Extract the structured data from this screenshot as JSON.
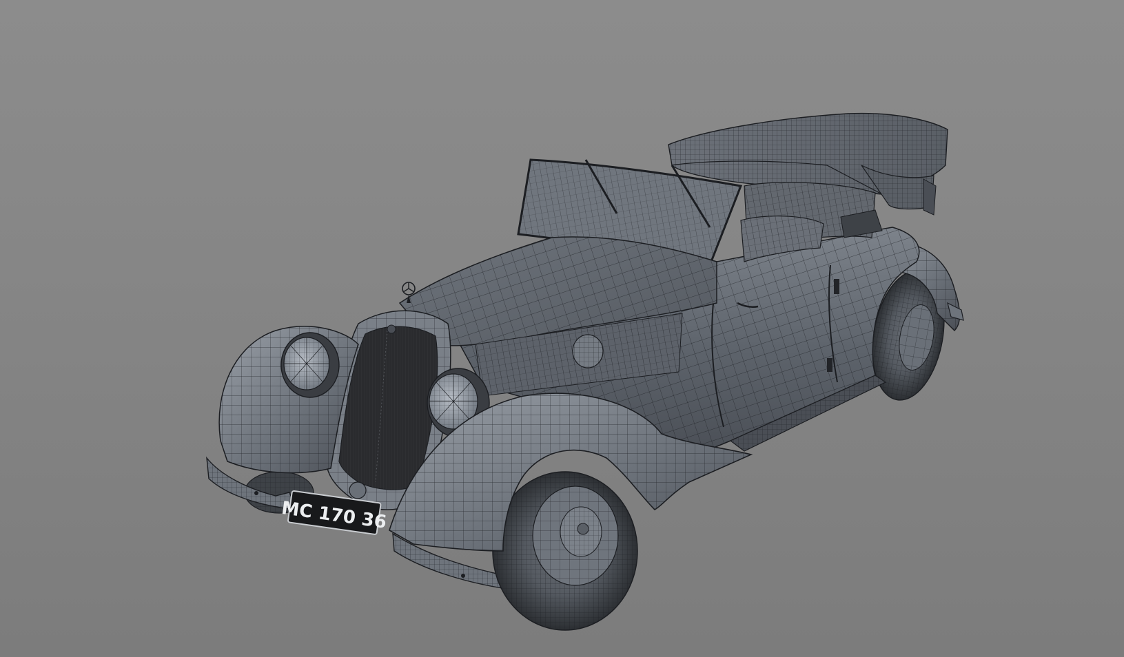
{
  "viewport": {
    "background_top": "#8c8c8c",
    "background_bottom": "#7c7c7c"
  },
  "model": {
    "plate_text": "MC 170 36",
    "body_color": "#5a5f66",
    "body_highlight": "#8a9098",
    "wire_color": "#1c1e22",
    "grille_color": "#2a2b2e",
    "emblem_icon": "three-pointed-star-emblem-icon"
  }
}
